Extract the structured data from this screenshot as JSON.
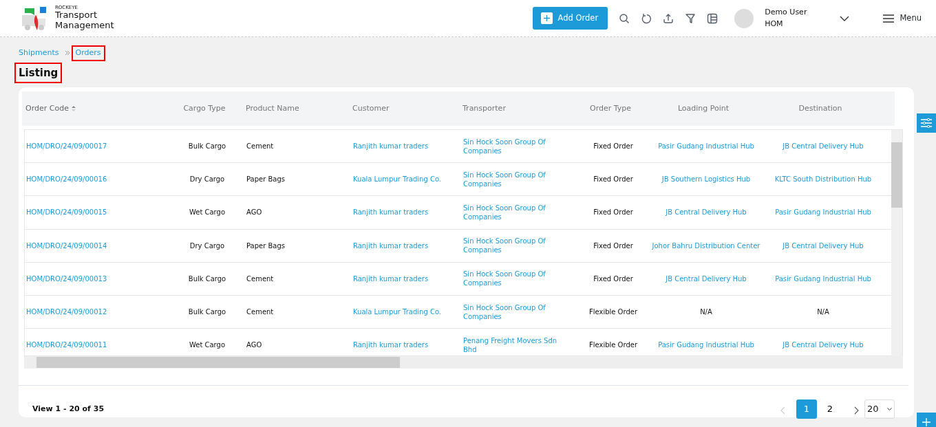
{
  "header": {
    "brand_small": "ROCKEYE",
    "brand_name": "Transport Management",
    "add_button": "Add Order",
    "user": {
      "name": "Demo User",
      "org": "HOM"
    },
    "menu_label": "Menu"
  },
  "breadcrumb": [
    {
      "label": "Shipments",
      "highlighted": false
    },
    {
      "label": "Orders",
      "highlighted": true
    }
  ],
  "page_title": {
    "text": "Listing",
    "highlighted": true
  },
  "table": {
    "columns": [
      {
        "label": "Order Code",
        "sorted": true
      },
      {
        "label": "Cargo Type",
        "sorted": false
      },
      {
        "label": "Product Name",
        "sorted": false
      },
      {
        "label": "Customer",
        "sorted": false
      },
      {
        "label": "Transporter",
        "sorted": false
      },
      {
        "label": "Order Type",
        "sorted": false
      },
      {
        "label": "Loading Point",
        "sorted": false
      },
      {
        "label": "Destination",
        "sorted": false
      }
    ],
    "rows": [
      [
        {
          "text": "HOM/DRO/24/09/00017",
          "link": true
        },
        {
          "text": "Bulk Cargo",
          "link": false
        },
        {
          "text": "Cement",
          "link": false
        },
        {
          "text": "Ranjith kumar traders",
          "link": true
        },
        {
          "text": "Sin Hock Soon Group Of Companies",
          "link": true
        },
        {
          "text": "Fixed Order",
          "link": false
        },
        {
          "text": "Pasir Gudang Industrial Hub",
          "link": true
        },
        {
          "text": "JB Central Delivery Hub",
          "link": true
        }
      ],
      [
        {
          "text": "HOM/DRO/24/09/00016",
          "link": true
        },
        {
          "text": "Dry Cargo",
          "link": false
        },
        {
          "text": "Paper Bags",
          "link": false
        },
        {
          "text": "Kuala Lumpur Trading Co.",
          "link": true
        },
        {
          "text": "Sin Hock Soon Group Of Companies",
          "link": true
        },
        {
          "text": "Fixed Order",
          "link": false
        },
        {
          "text": "JB Southern Logistics Hub",
          "link": true
        },
        {
          "text": "KLTC South Distribution Hub",
          "link": true
        }
      ],
      [
        {
          "text": "HOM/DRO/24/09/00015",
          "link": true
        },
        {
          "text": "Wet Cargo",
          "link": false
        },
        {
          "text": "AGO",
          "link": false
        },
        {
          "text": "Ranjith kumar traders",
          "link": true
        },
        {
          "text": "Sin Hock Soon Group Of Companies",
          "link": true
        },
        {
          "text": "Fixed Order",
          "link": false
        },
        {
          "text": "JB Central Delivery Hub",
          "link": true
        },
        {
          "text": "Pasir Gudang Industrial Hub",
          "link": true
        }
      ],
      [
        {
          "text": "HOM/DRO/24/09/00014",
          "link": true
        },
        {
          "text": "Dry Cargo",
          "link": false
        },
        {
          "text": "Paper Bags",
          "link": false
        },
        {
          "text": "Ranjith kumar traders",
          "link": true
        },
        {
          "text": "Sin Hock Soon Group Of Companies",
          "link": true
        },
        {
          "text": "Fixed Order",
          "link": false
        },
        {
          "text": "Johor Bahru Distribution Center",
          "link": true
        },
        {
          "text": "JB Central Delivery Hub",
          "link": true
        }
      ],
      [
        {
          "text": "HOM/DRO/24/09/00013",
          "link": true
        },
        {
          "text": "Bulk Cargo",
          "link": false
        },
        {
          "text": "Cement",
          "link": false
        },
        {
          "text": "Ranjith kumar traders",
          "link": true
        },
        {
          "text": "Sin Hock Soon Group Of Companies",
          "link": true
        },
        {
          "text": "Fixed Order",
          "link": false
        },
        {
          "text": "JB Central Delivery Hub",
          "link": true
        },
        {
          "text": "Pasir Gudang Industrial Hub",
          "link": true
        }
      ],
      [
        {
          "text": "HOM/DRO/24/09/00012",
          "link": true
        },
        {
          "text": "Bulk Cargo",
          "link": false
        },
        {
          "text": "Cement",
          "link": false
        },
        {
          "text": "Kuala Lumpur Trading Co.",
          "link": true
        },
        {
          "text": "Sin Hock Soon Group Of Companies",
          "link": true
        },
        {
          "text": "Flexible Order",
          "link": false
        },
        {
          "text": "N/A",
          "link": false
        },
        {
          "text": "N/A",
          "link": false
        }
      ],
      [
        {
          "text": "HOM/DRO/24/09/00011",
          "link": true
        },
        {
          "text": "Wet Cargo",
          "link": false
        },
        {
          "text": "AGO",
          "link": false
        },
        {
          "text": "Ranjith kumar traders",
          "link": true
        },
        {
          "text": "Penang Freight Movers Sdn Bhd",
          "link": true
        },
        {
          "text": "Flexible Order",
          "link": false
        },
        {
          "text": "Pasir Gudang Industrial Hub",
          "link": true
        },
        {
          "text": "JB Central Delivery Hub",
          "link": true
        }
      ]
    ]
  },
  "footer": {
    "summary": "View 1 - 20 of 35",
    "pages": [
      {
        "label": "1",
        "selected": true
      },
      {
        "label": "2",
        "selected": false
      }
    ],
    "prev_disabled": true,
    "next_disabled": false,
    "per_page": "20"
  }
}
